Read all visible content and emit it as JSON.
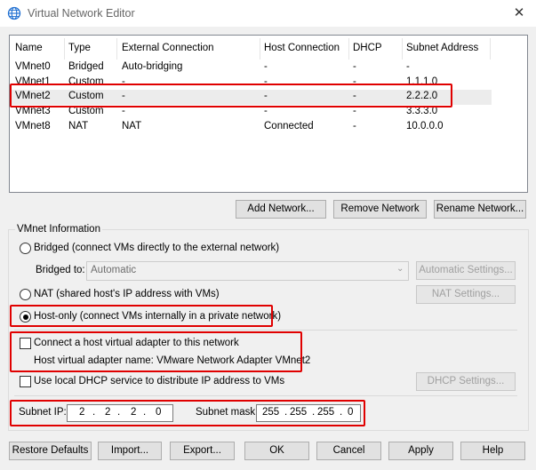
{
  "window": {
    "title": "Virtual Network Editor",
    "close_glyph": "✕",
    "icon": "globe-icon"
  },
  "table": {
    "headers": [
      "Name",
      "Type",
      "External Connection",
      "Host Connection",
      "DHCP",
      "Subnet Address"
    ],
    "rows": [
      {
        "name": "VMnet0",
        "type": "Bridged",
        "external": "Auto-bridging",
        "host": "-",
        "dhcp": "-",
        "subnet": "-"
      },
      {
        "name": "VMnet1",
        "type": "Custom",
        "external": "-",
        "host": "-",
        "dhcp": "-",
        "subnet": "1.1.1.0"
      },
      {
        "name": "VMnet2",
        "type": "Custom",
        "external": "-",
        "host": "-",
        "dhcp": "-",
        "subnet": "2.2.2.0"
      },
      {
        "name": "VMnet3",
        "type": "Custom",
        "external": "-",
        "host": "-",
        "dhcp": "-",
        "subnet": "3.3.3.0"
      },
      {
        "name": "VMnet8",
        "type": "NAT",
        "external": "NAT",
        "host": "Connected",
        "dhcp": "-",
        "subnet": "10.0.0.0"
      }
    ]
  },
  "network_buttons": {
    "add": "Add Network...",
    "remove": "Remove Network",
    "rename": "Rename Network..."
  },
  "vmnet_info": {
    "group_label": "VMnet Information",
    "bridged_radio": "Bridged (connect VMs directly to the external network)",
    "bridged_to_label": "Bridged to:",
    "bridged_to_value": "Automatic",
    "automatic_settings": "Automatic Settings...",
    "nat_radio": "NAT (shared host's IP address with VMs)",
    "nat_settings": "NAT Settings...",
    "host_only_radio": "Host-only (connect VMs internally in a private network)",
    "connect_adapter_checkbox": "Connect a host virtual adapter to this network",
    "adapter_name": "Host virtual adapter name: VMware Network Adapter VMnet2",
    "dhcp_checkbox": "Use local DHCP service to distribute IP address to VMs",
    "dhcp_settings": "DHCP Settings...",
    "subnet_ip_label": "Subnet IP:",
    "subnet_ip": [
      "2",
      "2",
      "2",
      "0"
    ],
    "subnet_mask_label": "Subnet mask:",
    "subnet_mask": [
      "255",
      "255",
      "255",
      "0"
    ],
    "ip_dot": "."
  },
  "footer": {
    "restore": "Restore Defaults",
    "import": "Import...",
    "export": "Export...",
    "ok": "OK",
    "cancel": "Cancel",
    "apply": "Apply",
    "help": "Help"
  },
  "state": {
    "selected_row": "VMnet2",
    "selected_mode": "host-only",
    "connect_adapter_checked": false,
    "dhcp_checked": false
  },
  "colors": {
    "highlight": "#e00000",
    "selected_row": "#ececec"
  }
}
